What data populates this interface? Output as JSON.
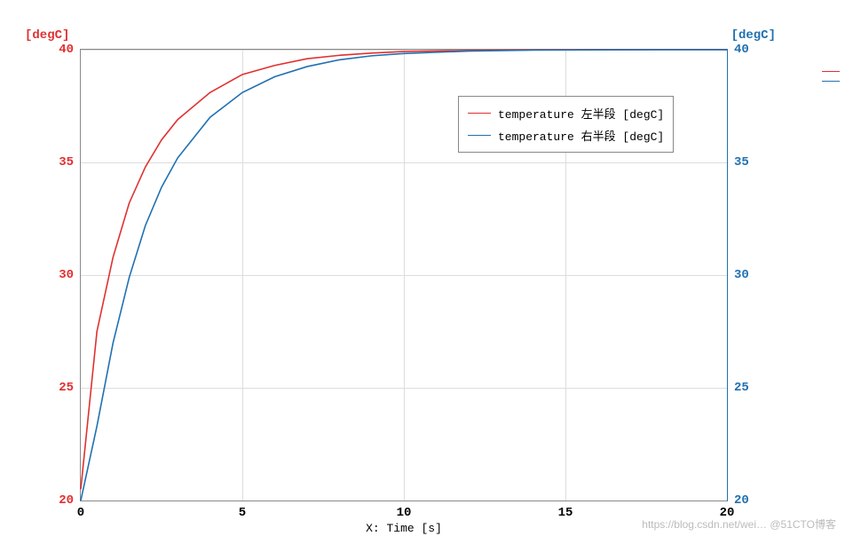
{
  "chart_data": {
    "type": "line",
    "title": "",
    "xlabel": "X: Time [s]",
    "ylabel_left": "[degC]",
    "ylabel_right": "[degC]",
    "xlim": [
      0,
      20
    ],
    "ylim": [
      20,
      40
    ],
    "x": [
      0,
      0.5,
      1,
      1.5,
      2,
      2.5,
      3,
      4,
      5,
      6,
      7,
      8,
      9,
      10,
      12,
      14,
      16,
      18,
      20
    ],
    "series": [
      {
        "name": "temperature 左半段 [degC]",
        "color": "#e03030",
        "values": [
          20.5,
          27.5,
          30.8,
          33.2,
          34.8,
          36.0,
          36.9,
          38.1,
          38.9,
          39.3,
          39.6,
          39.75,
          39.85,
          39.92,
          39.97,
          39.99,
          40.0,
          40.0,
          40.0
        ]
      },
      {
        "name": "temperature 右半段 [degC]",
        "color": "#2070b0",
        "values": [
          20.0,
          23.3,
          27.0,
          29.9,
          32.2,
          33.9,
          35.2,
          37.0,
          38.1,
          38.8,
          39.25,
          39.55,
          39.73,
          39.83,
          39.94,
          39.98,
          39.99,
          40.0,
          40.0
        ]
      }
    ],
    "xticks": [
      0,
      5,
      10,
      15,
      20
    ],
    "yticks": [
      20,
      25,
      30,
      35,
      40
    ],
    "legend_position": "upper-center"
  },
  "watermark": "https://blog.csdn.net/wei… @51CTO博客"
}
